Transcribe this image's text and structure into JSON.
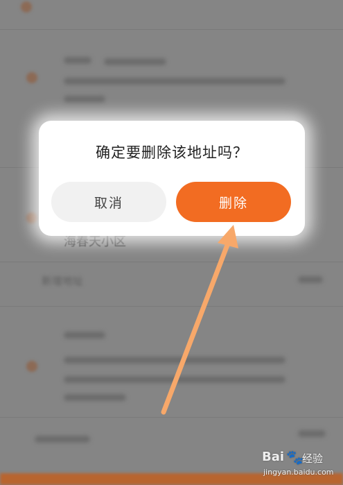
{
  "dialog": {
    "title": "确定要删除该地址吗？",
    "cancel_label": "取消",
    "delete_label": "删除"
  },
  "background": {
    "address_text": "海春天小区",
    "set_address_label": "新增地址"
  },
  "watermark": {
    "brand": "Bai",
    "paw": "🐾",
    "name": "经验",
    "url": "jingyan.baidu.com"
  },
  "colors": {
    "accent": "#f26c22",
    "arrow": "#f7a86a",
    "overlay": "#858585"
  },
  "icons": {
    "annotation": "arrow-annotation"
  }
}
